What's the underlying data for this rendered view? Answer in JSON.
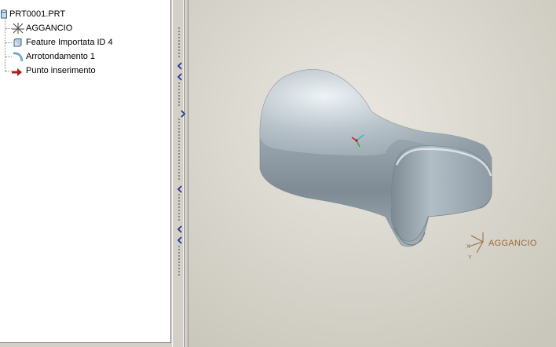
{
  "model_tree": {
    "items": [
      {
        "label": "PRT0001.PRT",
        "icon": "part-icon"
      },
      {
        "label": "AGGANCIO",
        "icon": "csys-icon"
      },
      {
        "label": "Feature Importata ID 4",
        "icon": "imported-feature-icon"
      },
      {
        "label": "Arrotondamento 1",
        "icon": "round-icon"
      },
      {
        "label": "Punto inserimento",
        "icon": "insert-arrow-icon"
      }
    ]
  },
  "viewport": {
    "csys_label": "AGGANCIO",
    "background_color": "#d9d7ce",
    "model_color": "#a6b3bb"
  }
}
